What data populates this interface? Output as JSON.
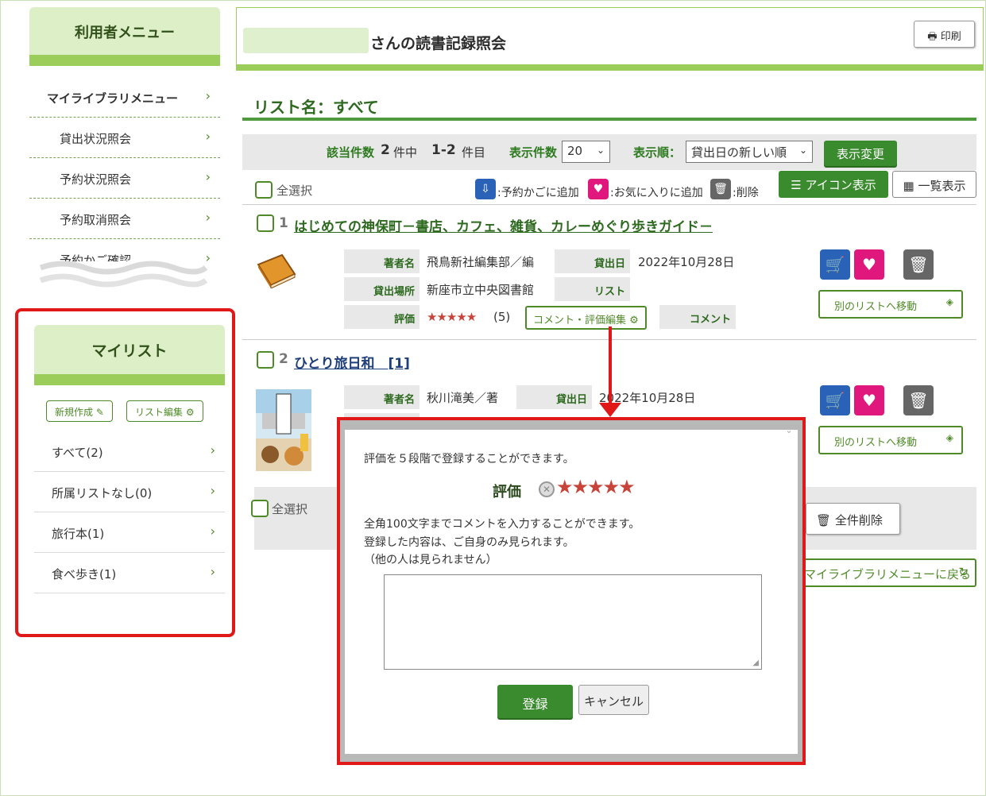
{
  "sidebar": {
    "user_menu_title": "利用者メニュー",
    "items": [
      {
        "label": "マイライブラリメニュー"
      },
      {
        "label": "貸出状況照会"
      },
      {
        "label": "予約状況照会"
      },
      {
        "label": "予約取消照会"
      },
      {
        "label": "予約かご確認"
      }
    ],
    "chevron": "›"
  },
  "mylist": {
    "title": "マイリスト",
    "new_button": "新規作成",
    "edit_button": "リスト編集",
    "items": [
      {
        "label": "すべて(2)"
      },
      {
        "label": "所属リストなし(0)"
      },
      {
        "label": "旅行本(1)"
      },
      {
        "label": "食べ歩き(1)"
      }
    ]
  },
  "header": {
    "title_suffix": "さんの読書記録照会",
    "print_button": "印刷"
  },
  "list": {
    "title": "リスト名：すべて"
  },
  "filter": {
    "hits_label": "該当件数",
    "hits_count": "2",
    "hits_unit": "件中",
    "range": "1-2",
    "range_unit": "件目",
    "per_page_label": "表示件数",
    "per_page_value": "20",
    "sort_label": "表示順：",
    "sort_value": "貸出日の新しい順",
    "apply_button": "表示変更"
  },
  "toolbar": {
    "select_all": "全選択",
    "legend_cart": ":予約かごに追加",
    "legend_fav": ":お気に入りに追加",
    "legend_delete": ":削除",
    "icon_view": "アイコン表示",
    "list_view": "一覧表示"
  },
  "labels": {
    "author": "著者名",
    "loan_date": "貸出日",
    "location": "貸出場所",
    "list": "リスト",
    "rating": "評価",
    "comment": "コメント",
    "comment_edit": "コメント・評価編集",
    "move_list": "別のリストへ移動"
  },
  "books": [
    {
      "number": "1",
      "title": "はじめての神保町－書店、カフェ、雑貨、カレーめぐり歩きガイド－",
      "author": "飛鳥新社編集部／編",
      "loan_date": "2022年10月28日",
      "location": "新座市立中央図書館",
      "rating_stars": "★★★★★",
      "rating_count": "(5)"
    },
    {
      "number": "2",
      "title": "ひとり旅日和　[1]",
      "author": "秋川滝美／著",
      "loan_date": "2022年10月28日"
    }
  ],
  "footer": {
    "select_all": "全選択",
    "delete_all": "全件削除",
    "return": "マイライブラリメニューに戻る"
  },
  "dialog": {
    "intro": "評価を５段階で登録することができます。",
    "rating_label": "評価",
    "stars": "★★★★★",
    "note_line1": "全角100文字までコメントを入力することができます。",
    "note_line2": "登録した内容は、ご自身のみ見られます。",
    "note_line3": "（他の人は見られません）",
    "register_button": "登録",
    "cancel_button": "キャンセル"
  },
  "colors": {
    "accent_green": "#3a8a2e",
    "light_green": "#dcefc6",
    "highlight_red": "#e01818",
    "cart_blue": "#2a62b8",
    "favorite_pink": "#e0187e"
  },
  "icons": [
    "chevron-right-icon",
    "printer-icon",
    "pencil-icon",
    "gear-icon",
    "cart-icon",
    "heart-plus-icon",
    "trash-icon",
    "list-icon",
    "grid-icon",
    "layers-icon",
    "refresh-icon",
    "close-icon",
    "clear-rating-icon",
    "star-icon"
  ]
}
